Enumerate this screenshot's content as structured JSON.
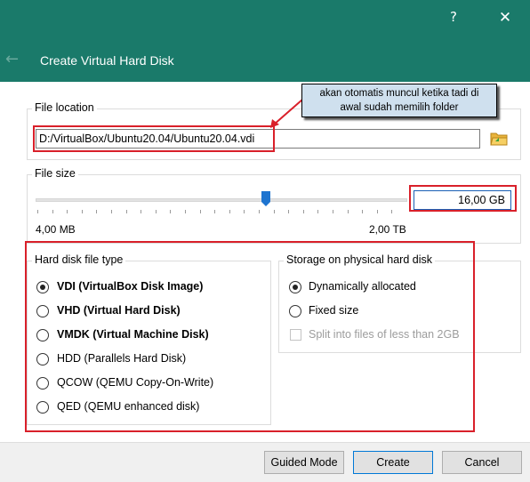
{
  "titlebar": {
    "help": "?",
    "close": "✕"
  },
  "header": {
    "back_icon": "←",
    "title": "Create Virtual Hard Disk"
  },
  "file_location": {
    "label": "File location",
    "path": "D:/VirtualBox/Ubuntu20.04/Ubuntu20.04.vdi",
    "folder_icon": "folder-icon"
  },
  "annotation": {
    "text": "akan otomatis muncul ketika tadi di awal sudah memilih folder",
    "line1": "akan otomatis muncul ketika tadi di",
    "line2": "awal sudah memilih folder"
  },
  "file_size": {
    "label": "File size",
    "min_label": "4,00 MB",
    "max_label": "2,00 TB",
    "value": "16,00 GB",
    "slider_position": 0.62
  },
  "disk_type": {
    "label": "Hard disk file type",
    "options": [
      {
        "label": "VDI (VirtualBox Disk Image)",
        "checked": true,
        "bold": true
      },
      {
        "label": "VHD (Virtual Hard Disk)",
        "checked": false,
        "bold": true
      },
      {
        "label": "VMDK (Virtual Machine Disk)",
        "checked": false,
        "bold": true
      },
      {
        "label": "HDD (Parallels Hard Disk)",
        "checked": false,
        "bold": false
      },
      {
        "label": "QCOW (QEMU Copy-On-Write)",
        "checked": false,
        "bold": false
      },
      {
        "label": "QED (QEMU enhanced disk)",
        "checked": false,
        "bold": false
      }
    ]
  },
  "storage": {
    "label": "Storage on physical hard disk",
    "options": [
      {
        "label": "Dynamically allocated",
        "checked": true
      },
      {
        "label": "Fixed size",
        "checked": false
      }
    ],
    "split_label": "Split into files of less than 2GB",
    "split_checked": false
  },
  "footer": {
    "guided_mode": "Guided Mode",
    "create": "Create",
    "cancel": "Cancel"
  },
  "colors": {
    "header_bg": "#1a7a6a",
    "annotation_red": "#d9202a",
    "callout_bg": "#cfe0ee"
  }
}
